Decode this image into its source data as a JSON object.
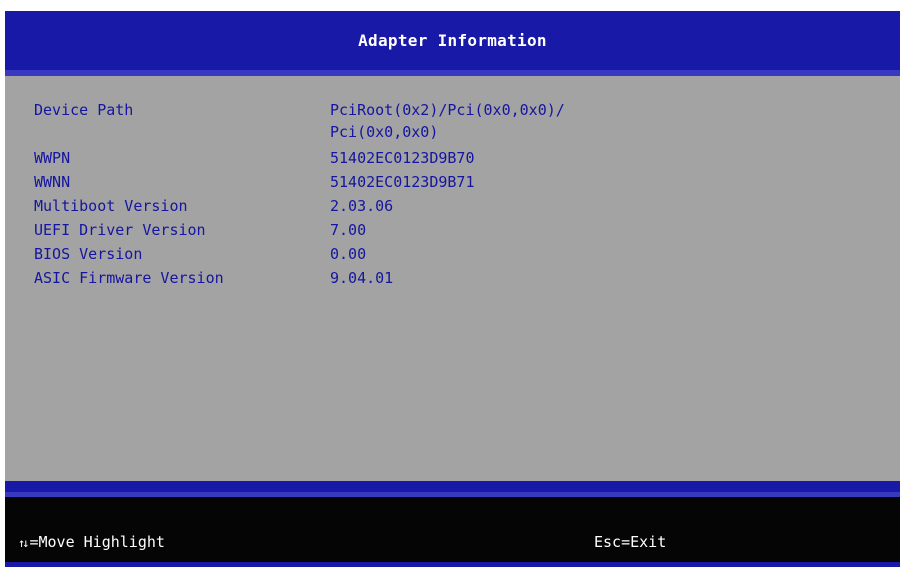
{
  "header": {
    "title": "Adapter Information"
  },
  "info": {
    "rows": [
      {
        "label": "Device Path",
        "value": "PciRoot(0x2)/Pci(0x0,0x0)/"
      },
      {
        "label": "",
        "value": "Pci(0x0,0x0)"
      },
      {
        "label": "WWPN",
        "value": "51402EC0123D9B70"
      },
      {
        "label": "WWNN",
        "value": "51402EC0123D9B71"
      },
      {
        "label": "Multiboot Version",
        "value": "2.03.06"
      },
      {
        "label": "UEFI Driver Version",
        "value": "7.00"
      },
      {
        "label": "BIOS Version",
        "value": "0.00"
      },
      {
        "label": "ASIC Firmware Version",
        "value": "9.04.01"
      }
    ]
  },
  "footer": {
    "move_icon": "up-down-arrows-icon",
    "move_arrows": "↑↓",
    "move_label": "=Move Highlight",
    "exit_label": "Esc=Exit"
  },
  "colors": {
    "title_bar": "#1919a8",
    "panel": "#a3a3a3",
    "text": "#1515a0",
    "footer": "#050505"
  }
}
